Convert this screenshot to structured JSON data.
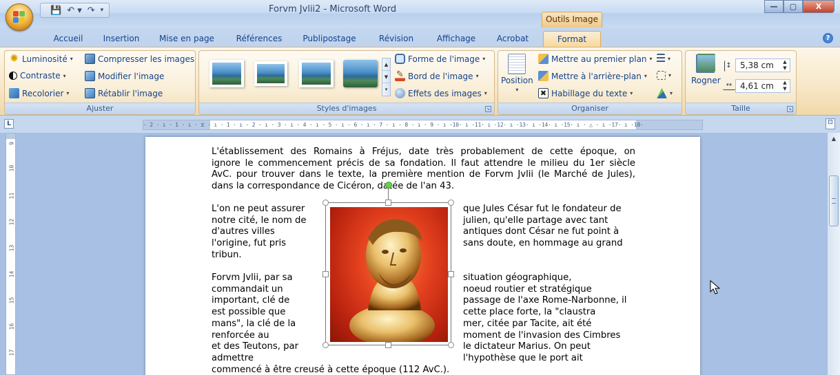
{
  "window": {
    "document_title": "Forvm Jvlii2 - Microsoft Word",
    "contextual_tab_group": "Outils Image",
    "controls": {
      "minimize": "—",
      "maximize": "▢",
      "close": "X"
    }
  },
  "tabs": [
    {
      "label": "Accueil"
    },
    {
      "label": "Insertion"
    },
    {
      "label": "Mise en page"
    },
    {
      "label": "Références"
    },
    {
      "label": "Publipostage"
    },
    {
      "label": "Révision"
    },
    {
      "label": "Affichage"
    },
    {
      "label": "Acrobat"
    },
    {
      "label": "Format"
    }
  ],
  "active_tab": "Format",
  "ribbon": {
    "ajuster": {
      "label": "Ajuster",
      "luminosite": "Luminosité",
      "contraste": "Contraste",
      "recolorier": "Recolorier",
      "compresser": "Compresser les images",
      "modifier": "Modifier l'image",
      "retablir": "Rétablir l'image"
    },
    "styles": {
      "label": "Styles d'images",
      "forme": "Forme de l'image",
      "bord": "Bord de l'image",
      "effets": "Effets des images"
    },
    "organiser": {
      "label": "Organiser",
      "position": "Position",
      "premier_plan": "Mettre au premier plan",
      "arriere_plan": "Mettre à l'arrière-plan",
      "habillage": "Habillage du texte"
    },
    "taille": {
      "label": "Taille",
      "rogner": "Rogner",
      "height": "5,38 cm",
      "width": "4,61 cm"
    }
  },
  "ruler": {
    "horizontal": "· 2 · ı · 1 · ı · ⧖ · ı · 1 · ı · 2 · ı · 3 · ı · 4 · ı · 5 · ı · 6 · ı · 7 · ı · 8 · ı · 9 · ı ·10· ı ·11· ı ·12· ı ·13· ı ·14· ı ·15· ı · △ · ı ·17· ı ·18·",
    "vertical": [
      "9",
      "10",
      "11",
      "12",
      "13",
      "14",
      "15",
      "16",
      "17"
    ],
    "corner": "L"
  },
  "document": {
    "para1": [
      "L'établissement des Romains à Fréjus, date très probablement de cette époque, on",
      "ignore le commencement précis de sa fondation. Il faut attendre le milieu du 1er siècle",
      "AvC. pour trouver dans le texte, la première mention de Forvm Jvlii (le Marché de Jules),",
      "dans la correspondance de Cicéron, datée de l'an 43."
    ],
    "para2_left": [
      "L'on ne peut assurer",
      "notre cité, le nom de",
      "d'autres villes",
      "l'origine, fut pris",
      "tribun."
    ],
    "para2_right": [
      "que Jules César fut le fondateur de",
      "julien, qu'elle partage avec tant",
      "antiques dont César ne fut point à",
      "sans doute, en hommage au grand"
    ],
    "para3_left": [
      "Forvm Jvlii, par sa",
      "commandait un",
      "important, clé de",
      "est possible que",
      "mans\", la clé de la",
      "renforcée au",
      "et des Teutons, par",
      "admettre"
    ],
    "para3_right": [
      "situation géographique,",
      "noeud routier et stratégique",
      "passage de l'axe Rome-Narbonne, il",
      "cette place forte, la \"claustra",
      "mer, citée par Tacite, ait été",
      "moment de l'invasion des Cimbres",
      "le dictateur Marius. On peut",
      "l'hypothèse que le port ait"
    ],
    "last_line": "commencé à être creusé à cette époque (112 AvC.)."
  }
}
